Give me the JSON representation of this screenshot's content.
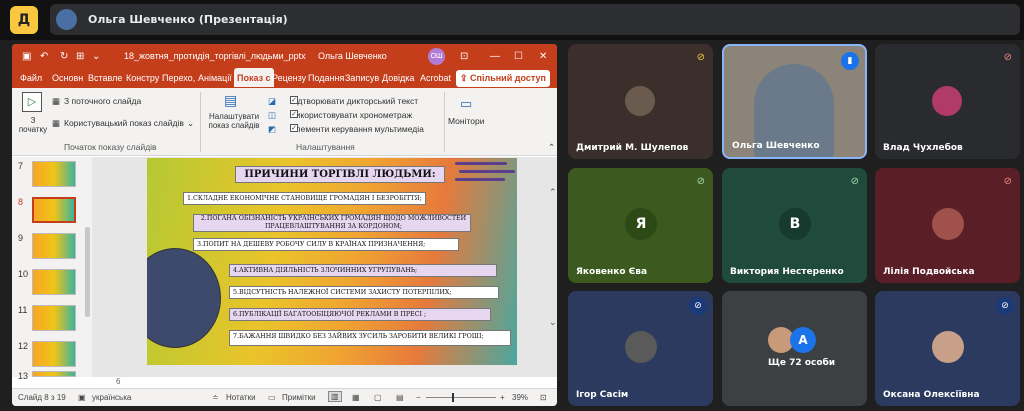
{
  "meet": {
    "logo": "Д",
    "presenter_title": "Ольга Шевченко (Презентація)",
    "brand_color": "#f9c740"
  },
  "ppt": {
    "filename": "18_жовтня_протидія_торгівлі_людьми_pptx",
    "user": "Ольга Шевченко",
    "user_initials": "ОШ",
    "tabs": [
      "Файл",
      "Основн",
      "Вставле",
      "Констру",
      "Перехо,",
      "Анімації",
      "Показ с",
      "Рецензу",
      "Подання",
      "Записув",
      "Довідка",
      "Acrobat"
    ],
    "active_tab": "Показ с",
    "share_label": "Спільний доступ",
    "ribbon": {
      "from_start_label": "З початку",
      "from_current_label": "З поточного слайда",
      "custom_show_label": "Користувацький показ слайдів",
      "group1_label": "Початок показу слайдів",
      "setup_label": "Налаштувати показ слайдів",
      "play_narration": "Відтворювати дикторський текст",
      "use_timings": "Використовувати хронометраж",
      "media_controls": "Елементи керування мультимедіа",
      "group2_label": "Налаштування",
      "monitors_label": "Монітори"
    },
    "thumbnails": [
      {
        "num": "7",
        "selected": false
      },
      {
        "num": "8",
        "selected": true
      },
      {
        "num": "9",
        "selected": false
      },
      {
        "num": "10",
        "selected": false
      },
      {
        "num": "11",
        "selected": false
      },
      {
        "num": "12",
        "selected": false
      },
      {
        "num": "13",
        "selected": false
      }
    ],
    "slide": {
      "title": "ПРИЧИНИ ТОРГІВЛІ ЛЮДЬМИ:",
      "lines": [
        "1.СКЛАДНЕ ЕКОНОМІЧНЕ СТАНОВИЩЕ ГРОМАДЯН І БЕЗРОБІТТЯ;",
        "2.ПОГАНА ОБІЗНАНІСТЬ УКРАЇНСЬКИХ ГРОМАДЯН ЩОДО МОЖЛИВОСТЕЙ ПРАЦЕВЛАШТУВАННЯ ЗА КОРДОНОМ;",
        "3.ПОПИТ НА ДЕШЕВУ РОБОЧУ СИЛУ В КРАЇНАХ ПРИЗНАЧЕННЯ;",
        "4.АКТИВНА ДІЯЛЬНІСТЬ ЗЛОЧИННИХ УГРУПУВАНЬ;",
        "5.ВІДСУТНІСТЬ НАЛЕЖНОЇ СИСТЕМИ ЗАХИСТУ ПОТЕРПІЛИХ;",
        "6.ПУБЛІКАЦІЇ БАГАТООБІЦЯЮЧОЇ РЕКЛАМИ В ПРЕСІ ;",
        "7.БАЖАННЯ ШВИДКО БЕЗ ЗАЙВИХ ЗУСИЛЬ ЗАРОБИТИ ВЕЛИКІ ГРОШІ;"
      ]
    },
    "notes_num": "6",
    "status": {
      "slide_of": "Слайд 8 з 19",
      "language": "українська",
      "notes_label": "Нотатки",
      "comments_label": "Примітки",
      "zoom": "39%"
    }
  },
  "participants": [
    {
      "name": "Дмитрий М. Шулепов",
      "muted": true
    },
    {
      "name": "Ольга Шевченко",
      "muted": false
    },
    {
      "name": "Влад Чухлебов",
      "muted": true
    },
    {
      "name": "Яковенко Єва",
      "initial": "Я",
      "muted": true
    },
    {
      "name": "Виктория Нестеренко",
      "initial": "В",
      "muted": true
    },
    {
      "name": "Лілія Подвойська",
      "muted": true
    },
    {
      "name": "Ігор Сасім",
      "muted": true
    },
    {
      "name": "Ще 72 особи",
      "initial": "А"
    },
    {
      "name": "Оксана Олексіївна",
      "muted": true
    }
  ]
}
